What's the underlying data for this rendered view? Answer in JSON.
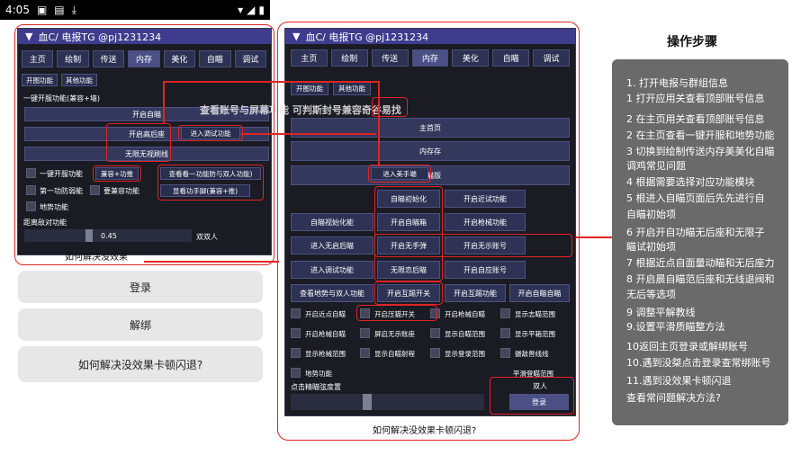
{
  "status_bar": {
    "time": "4:05"
  },
  "left_panel": {
    "title": "血C/ 电报TG @pj1231234",
    "tabs": [
      "主页",
      "绘制",
      "传送",
      "内存",
      "美化",
      "自瞄",
      "调试"
    ],
    "active_tab": "内存",
    "sub_buttons": [
      "开图功能",
      "其他功能"
    ],
    "section_label": "一键开服功能(兼容+墙)",
    "buttons": [
      "开启自瞄",
      "开启高后座",
      "无限无视刷线"
    ],
    "popup_tag": "进入调试功能",
    "checks": [
      {
        "label": "一键开服功能",
        "tag": "兼容+功推"
      },
      {
        "label": "第一功防弱能",
        "tag": "要兼容功能"
      },
      {
        "label": "地势功能",
        "tag": ""
      }
    ],
    "side_buttons": [
      "查看看一功能防与双人功能)",
      "显看功手脚(兼容+推)"
    ],
    "slider_label": "距离敌对功能",
    "slider_value": "0.45",
    "slider_right_label": "双双人",
    "caption": "如何解决没效果"
  },
  "gray_buttons": [
    "登录",
    "解绑",
    "如何解决没效果卡顿闪退?"
  ],
  "center_panel": {
    "title": "血C/ 电报TG @pj1231234",
    "tabs": [
      "主页",
      "绘制",
      "传送",
      "内存",
      "美化",
      "自瞄",
      "调试"
    ],
    "active_tab": "内存",
    "sub_buttons": [
      "开图功能",
      "其他功能"
    ],
    "overlay_text": "查看账号与屏幕功能 可判斯封号兼容奇谷易找",
    "wide_buttons": [
      "主首页",
      "内存存",
      "自瞄版"
    ],
    "enter_tag": "进入美手端",
    "row1": [
      "自瞄初始化",
      "开启近试功能"
    ],
    "row2": [
      "自瞄视始化能",
      "开启自瞄箱",
      "开启枪械功能"
    ],
    "row3": [
      "进入无启后瞄",
      "开启无手弹",
      "开启无示账号"
    ],
    "row4": [
      "进入调试功能",
      "无限恋后瞄",
      "开启自应账号"
    ],
    "row5": [
      "查看地势与双人功能",
      "开启互踢开关",
      "开启互踢功能",
      "开启自瞄自瞄"
    ],
    "check_rows": [
      [
        "开启近点自瞄",
        "开启压猫开关",
        "开启枪械自瞄",
        "显示志瞄范围"
      ],
      [
        "开启枪械自瞄",
        "屏启无示账座",
        "显示自瞄范围",
        "显示平箱范围"
      ],
      [
        "显示枪械范围",
        "显示自瞄射程",
        "显示登录范围",
        "摄敌兽线线"
      ],
      [
        "地势功能",
        "",
        "",
        "平滑登瞄范围"
      ]
    ],
    "slider_label": "点击精瞄弦度置",
    "duo_label": "双人",
    "login_label": "登录",
    "caption": "如何解决没效果卡顿闪退?"
  },
  "steps": {
    "title": "操作步骤",
    "items": [
      "1. 打开电报与群组信息",
      "1 打开应用关查看顶部账号信息",
      "2 在主页用关查看顶部账号信息",
      "2 在主页查看一键开服和地势功能",
      "3 切换到绘制传送内存美美化自瞄",
      "调鸡常见问题",
      "4 根据需要选择对应功能模块",
      "5 根进入自瞄页面后先先进行自",
      "自瞄初始项",
      "6 开启开自功瞄无后座和无限子",
      "瞄试初始项",
      "7 根据近点自面量动瞄和无后座力",
      "8 开启晨自瞄范后座和无线退阀和",
      "无后等选项",
      "9 调整平解教线",
      "9.设置平滑质瞄整方法",
      "10返回主页登录或解绑账号",
      "10.遇到没桀点击登录查常绑账号",
      "11.遇到没效果卡顿闪退",
      "查看常问题解决方法?"
    ]
  },
  "colors": {
    "accent": "#3f3c8e",
    "panel_bg": "#1b1b24",
    "annotation": "#e02424"
  }
}
